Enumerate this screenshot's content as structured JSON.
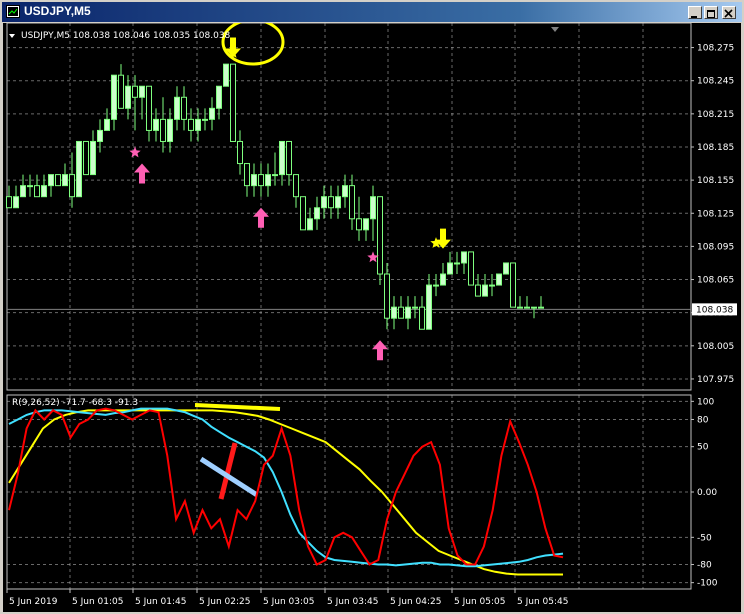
{
  "window": {
    "title": "USDJPY,M5"
  },
  "main_chart": {
    "info_label": "USDJPY,M5  108.038 108.046 108.035 108.038",
    "price_levels": [
      "108.275",
      "108.245",
      "108.215",
      "108.185",
      "108.155",
      "108.125",
      "108.095",
      "108.065",
      "108.035",
      "108.005",
      "107.975"
    ],
    "current_price_label": "108.038",
    "candles": [
      [
        108.14,
        108.15,
        108.13,
        108.13
      ],
      [
        108.13,
        108.15,
        108.13,
        108.14
      ],
      [
        108.14,
        108.16,
        108.14,
        108.15
      ],
      [
        108.15,
        108.16,
        108.14,
        108.15
      ],
      [
        108.15,
        108.16,
        108.14,
        108.14
      ],
      [
        108.14,
        108.16,
        108.14,
        108.15
      ],
      [
        108.15,
        108.16,
        108.14,
        108.16
      ],
      [
        108.16,
        108.16,
        108.15,
        108.15
      ],
      [
        108.15,
        108.17,
        108.15,
        108.16
      ],
      [
        108.16,
        108.18,
        108.13,
        108.14
      ],
      [
        108.14,
        108.19,
        108.14,
        108.19
      ],
      [
        108.19,
        108.19,
        108.16,
        108.16
      ],
      [
        108.16,
        108.2,
        108.16,
        108.19
      ],
      [
        108.19,
        108.21,
        108.18,
        108.2
      ],
      [
        108.2,
        108.22,
        108.2,
        108.21
      ],
      [
        108.21,
        108.25,
        108.2,
        108.25
      ],
      [
        108.25,
        108.26,
        108.22,
        108.22
      ],
      [
        108.22,
        108.25,
        108.21,
        108.24
      ],
      [
        108.24,
        108.25,
        108.2,
        108.23
      ],
      [
        108.23,
        108.24,
        108.21,
        108.24
      ],
      [
        108.24,
        108.24,
        108.19,
        108.2
      ],
      [
        108.2,
        108.22,
        108.19,
        108.21
      ],
      [
        108.21,
        108.23,
        108.18,
        108.19
      ],
      [
        108.19,
        108.22,
        108.18,
        108.21
      ],
      [
        108.21,
        108.24,
        108.2,
        108.23
      ],
      [
        108.23,
        108.24,
        108.2,
        108.21
      ],
      [
        108.21,
        108.22,
        108.19,
        108.2
      ],
      [
        108.2,
        108.22,
        108.19,
        108.21
      ],
      [
        108.21,
        108.22,
        108.2,
        108.21
      ],
      [
        108.21,
        108.23,
        108.2,
        108.22
      ],
      [
        108.22,
        108.24,
        108.21,
        108.24
      ],
      [
        108.24,
        108.26,
        108.24,
        108.26
      ],
      [
        108.26,
        108.26,
        108.19,
        108.19
      ],
      [
        108.19,
        108.2,
        108.16,
        108.17
      ],
      [
        108.17,
        108.17,
        108.14,
        108.15
      ],
      [
        108.15,
        108.17,
        108.14,
        108.16
      ],
      [
        108.16,
        108.17,
        108.14,
        108.15
      ],
      [
        108.15,
        108.17,
        108.14,
        108.16
      ],
      [
        108.16,
        108.18,
        108.15,
        108.16
      ],
      [
        108.16,
        108.19,
        108.15,
        108.19
      ],
      [
        108.19,
        108.19,
        108.15,
        108.16
      ],
      [
        108.16,
        108.16,
        108.13,
        108.14
      ],
      [
        108.14,
        108.14,
        108.11,
        108.11
      ],
      [
        108.11,
        108.13,
        108.11,
        108.12
      ],
      [
        108.12,
        108.14,
        108.11,
        108.13
      ],
      [
        108.13,
        108.15,
        108.12,
        108.14
      ],
      [
        108.14,
        108.15,
        108.12,
        108.13
      ],
      [
        108.13,
        108.15,
        108.12,
        108.14
      ],
      [
        108.14,
        108.16,
        108.13,
        108.15
      ],
      [
        108.15,
        108.16,
        108.11,
        108.12
      ],
      [
        108.12,
        108.14,
        108.1,
        108.11
      ],
      [
        108.11,
        108.12,
        108.1,
        108.12
      ],
      [
        108.12,
        108.15,
        108.1,
        108.14
      ],
      [
        108.14,
        108.14,
        108.06,
        108.07
      ],
      [
        108.07,
        108.08,
        108.02,
        108.03
      ],
      [
        108.03,
        108.05,
        108.02,
        108.04
      ],
      [
        108.04,
        108.05,
        108.03,
        108.03
      ],
      [
        108.03,
        108.05,
        108.02,
        108.04
      ],
      [
        108.04,
        108.05,
        108.03,
        108.04
      ],
      [
        108.04,
        108.05,
        108.02,
        108.02
      ],
      [
        108.02,
        108.07,
        108.02,
        108.06
      ],
      [
        108.06,
        108.07,
        108.05,
        108.06
      ],
      [
        108.06,
        108.08,
        108.06,
        108.07
      ],
      [
        108.07,
        108.09,
        108.07,
        108.08
      ],
      [
        108.08,
        108.09,
        108.07,
        108.08
      ],
      [
        108.08,
        108.09,
        108.07,
        108.09
      ],
      [
        108.09,
        108.09,
        108.06,
        108.06
      ],
      [
        108.06,
        108.07,
        108.05,
        108.05
      ],
      [
        108.05,
        108.07,
        108.05,
        108.06
      ],
      [
        108.06,
        108.07,
        108.05,
        108.06
      ],
      [
        108.06,
        108.07,
        108.06,
        108.07
      ],
      [
        108.07,
        108.08,
        108.07,
        108.08
      ],
      [
        108.08,
        108.08,
        108.04,
        108.04
      ],
      [
        108.04,
        108.05,
        108.04,
        108.04
      ],
      [
        108.04,
        108.05,
        108.04,
        108.04
      ],
      [
        108.04,
        108.04,
        108.03,
        108.04
      ],
      [
        108.04,
        108.05,
        108.04,
        108.04
      ]
    ],
    "arrows": [
      {
        "index": 36,
        "dir": "up",
        "price": 108.13,
        "color": "#ff5fb4",
        "icon": "arrow-up-icon"
      },
      {
        "index": 19,
        "dir": "up",
        "price": 108.17,
        "color": "#ff5fb4",
        "icon": "arrow-up-icon"
      },
      {
        "index": 53,
        "dir": "up",
        "price": 108.01,
        "color": "#ff5fb4",
        "icon": "arrow-up-icon"
      },
      {
        "index": 32,
        "dir": "down",
        "price": 108.266,
        "color": "#ffff00",
        "icon": "arrow-down-icon"
      },
      {
        "index": 62,
        "dir": "down",
        "price": 108.093,
        "color": "#ffff00",
        "icon": "arrow-down-icon"
      }
    ],
    "stars": [
      {
        "index": 18,
        "price": 108.18,
        "color": "#ff5fb4"
      },
      {
        "index": 52,
        "price": 108.085,
        "color": "#ff5fb4"
      },
      {
        "index": 61,
        "price": 108.098,
        "color": "#ffff00"
      },
      {
        "index": 32,
        "price": 108.27,
        "color": "#ffff00"
      }
    ]
  },
  "indicator": {
    "info_label": "R(9,26,52) -71.7 -68.3 -91.3",
    "levels": [
      "100",
      "80",
      "50",
      "0.00",
      "-50",
      "-80",
      "-100"
    ],
    "red_series": [
      -20,
      20,
      70,
      90,
      80,
      90,
      85,
      60,
      75,
      80,
      90,
      92,
      90,
      85,
      80,
      85,
      90,
      88,
      40,
      -30,
      -10,
      -45,
      -20,
      -40,
      -30,
      -60,
      -20,
      -30,
      -10,
      30,
      40,
      70,
      40,
      -20,
      -60,
      -80,
      -75,
      -50,
      -45,
      -50,
      -65,
      -80,
      -75,
      -30,
      0,
      20,
      40,
      50,
      55,
      30,
      -40,
      -70,
      -80,
      -80,
      -60,
      -20,
      40,
      78,
      55,
      30,
      0,
      -40,
      -70,
      -72
    ],
    "yellow_series": [
      10,
      30,
      50,
      70,
      80,
      85,
      88,
      90,
      90,
      90,
      90,
      90,
      90,
      90,
      90,
      90,
      90,
      90,
      90,
      89,
      88,
      86,
      84,
      80,
      75,
      70,
      65,
      60,
      55,
      45,
      35,
      25,
      12,
      0,
      -15,
      -30,
      -45,
      -55,
      -65,
      -70,
      -75,
      -80,
      -85,
      -88,
      -90,
      -91,
      -91,
      -91,
      -91,
      -91
    ],
    "cyan_series": [
      75,
      80,
      85,
      88,
      90,
      90,
      90,
      89,
      88,
      87,
      86,
      85,
      87,
      88,
      90,
      92,
      92,
      92,
      92,
      90,
      88,
      84,
      80,
      72,
      66,
      60,
      55,
      50,
      45,
      38,
      22,
      0,
      -25,
      -45,
      -55,
      -65,
      -72,
      -75,
      -76,
      -77,
      -78,
      -79,
      -80,
      -80,
      -81,
      -80,
      -79,
      -78,
      -78,
      -80,
      -80,
      -81,
      -82,
      -82,
      -81,
      -80,
      -79,
      -78,
      -77,
      -75,
      -72,
      -70,
      -69,
      -68
    ]
  },
  "time_axis": {
    "labels": [
      "5 Jun 2019",
      "5 Jun 01:05",
      "5 Jun 01:45",
      "5 Jun 02:25",
      "5 Jun 03:05",
      "5 Jun 03:45",
      "5 Jun 04:25",
      "5 Jun 05:05",
      "5 Jun 05:45"
    ]
  },
  "colors": {
    "background": "#000000",
    "grid": "#c0c0c0",
    "bull_candle": "#ccffcc",
    "bear_candle": "#000000",
    "candle_wick": "#7fff7f",
    "red_line": "#ff0000",
    "yellow_line": "#ffff00",
    "cyan_line": "#40e0ff",
    "annotation_yellow": "#ffff00",
    "annotation_red": "#ff0000",
    "annotation_blue": "#7fbfff"
  }
}
